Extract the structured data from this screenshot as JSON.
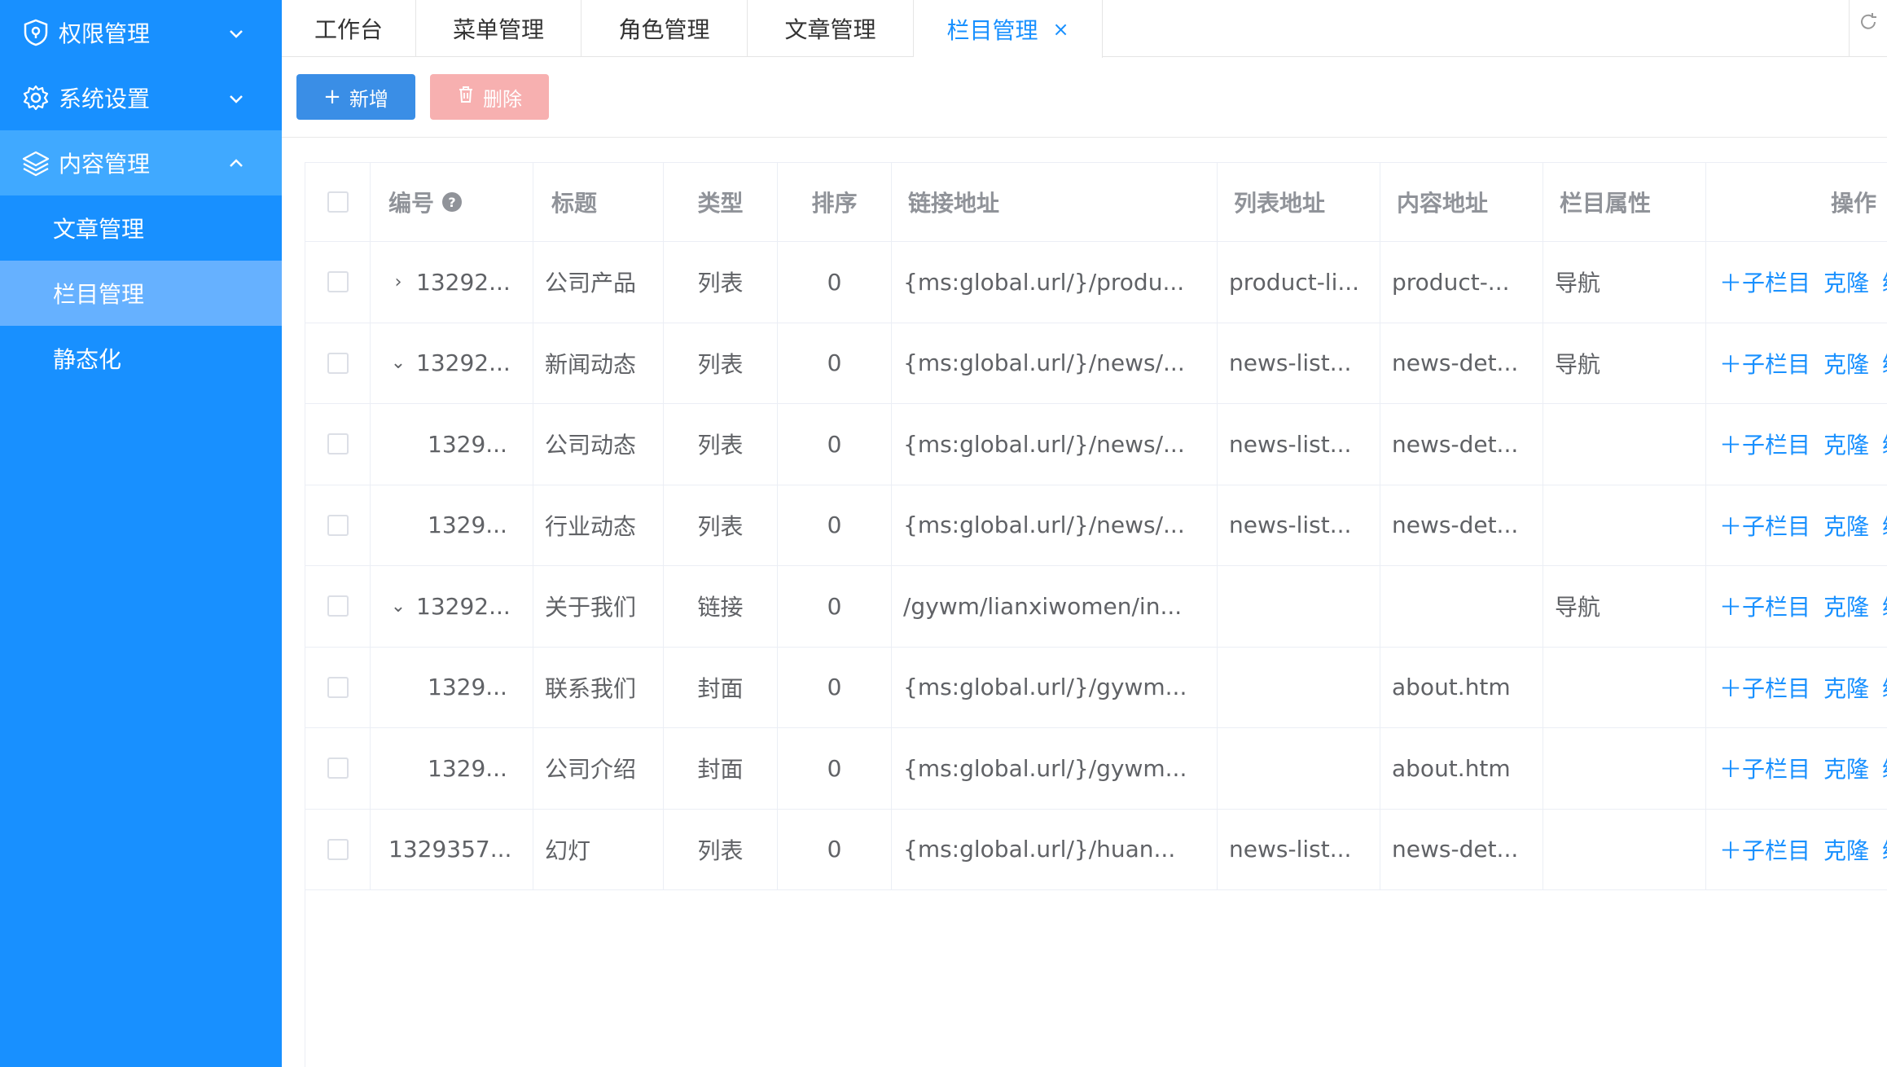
{
  "sidebar": {
    "groups": [
      {
        "label": "权限管理",
        "icon": "shield-icon",
        "expanded": false
      },
      {
        "label": "系统设置",
        "icon": "gear-icon",
        "expanded": false
      },
      {
        "label": "内容管理",
        "icon": "layers-icon",
        "expanded": true
      }
    ],
    "subitems": [
      {
        "label": "文章管理",
        "active": false
      },
      {
        "label": "栏目管理",
        "active": true
      },
      {
        "label": "静态化",
        "active": false
      }
    ]
  },
  "tabs": [
    {
      "label": "工作台"
    },
    {
      "label": "菜单管理"
    },
    {
      "label": "角色管理"
    },
    {
      "label": "文章管理"
    },
    {
      "label": "栏目管理",
      "active": true,
      "close": "×"
    }
  ],
  "toolbar": {
    "add_label": "新增",
    "add_icon": "+",
    "delete_label": "删除"
  },
  "table": {
    "headers": [
      "编号",
      "标题",
      "类型",
      "排序",
      "链接地址",
      "列表地址",
      "内容地址",
      "栏目属性",
      "操作"
    ],
    "help_icon": "?",
    "rows": [
      {
        "expand": "›",
        "id": "13292...",
        "title": "公司产品",
        "type": "列表",
        "sort": "0",
        "link": "{ms:global.url/}/produ...",
        "list": "product-li...",
        "content": "product-...",
        "attr": "导航",
        "level": 0
      },
      {
        "expand": "⌄",
        "id": "13292...",
        "title": "新闻动态",
        "type": "列表",
        "sort": "0",
        "link": "{ms:global.url/}/news/...",
        "list": "news-list...",
        "content": "news-det...",
        "attr": "导航",
        "level": 0
      },
      {
        "expand": "",
        "id": "1329...",
        "title": "公司动态",
        "type": "列表",
        "sort": "0",
        "link": "{ms:global.url/}/news/...",
        "list": "news-list...",
        "content": "news-det...",
        "attr": "",
        "level": 1
      },
      {
        "expand": "",
        "id": "1329...",
        "title": "行业动态",
        "type": "列表",
        "sort": "0",
        "link": "{ms:global.url/}/news/...",
        "list": "news-list...",
        "content": "news-det...",
        "attr": "",
        "level": 1
      },
      {
        "expand": "⌄",
        "id": "13292...",
        "title": "关于我们",
        "type": "链接",
        "sort": "0",
        "link": "/gywm/lianxiwomen/in...",
        "list": "",
        "content": "",
        "attr": "导航",
        "level": 0
      },
      {
        "expand": "",
        "id": "1329...",
        "title": "联系我们",
        "type": "封面",
        "sort": "0",
        "link": "{ms:global.url/}/gywm...",
        "list": "",
        "content": "about.htm",
        "attr": "",
        "level": 1
      },
      {
        "expand": "",
        "id": "1329...",
        "title": "公司介绍",
        "type": "封面",
        "sort": "0",
        "link": "{ms:global.url/}/gywm...",
        "list": "",
        "content": "about.htm",
        "attr": "",
        "level": 1
      },
      {
        "expand": "",
        "id": "1329357...",
        "title": "幻灯",
        "type": "列表",
        "sort": "0",
        "link": "{ms:global.url/}/huan...",
        "list": "news-list...",
        "content": "news-det...",
        "attr": "",
        "level": -1
      }
    ],
    "actions": [
      "＋子栏目",
      "克隆",
      "编"
    ]
  },
  "colors": {
    "sidebar": "#1890ff",
    "accent": "#1890ff",
    "danger_light": "#f7b0b0"
  }
}
